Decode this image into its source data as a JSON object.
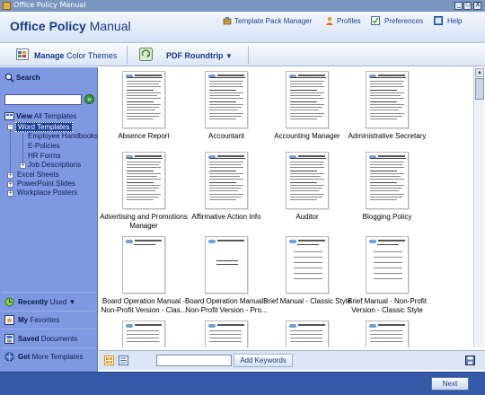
{
  "window": {
    "title": "Office Policy Manual",
    "controls": [
      "_",
      "□",
      "X"
    ]
  },
  "header": {
    "brand_bold": "Office Policy",
    "brand_light": " Manual",
    "links": [
      {
        "label": "Template Pack Manager",
        "icon": "package-icon"
      },
      {
        "label": "Profiles",
        "icon": "profile-icon"
      },
      {
        "label": "Preferences",
        "icon": "preferences-icon"
      },
      {
        "label": "Help",
        "icon": "help-icon"
      }
    ]
  },
  "toolbar": {
    "manage_bold": "Manage",
    "manage_rest": " Color Themes",
    "pdf_label": "PDF Roundtrip",
    "pdf_dropdown": "▼"
  },
  "sidebar": {
    "search_label": "Search",
    "search_go": "»",
    "view_bold": "View",
    "view_rest": " All Templates",
    "tree": [
      {
        "label": "Word Templates",
        "toggle": "−",
        "selected": true
      },
      {
        "label": "Employee Handbooks"
      },
      {
        "label": "E-Policies"
      },
      {
        "label": "HR Forms"
      },
      {
        "label": "Job Descriptions",
        "toggle": "+"
      },
      {
        "label": "Excel Sheets",
        "toggle": "+"
      },
      {
        "label": "PowerPoint Slides",
        "toggle": "+"
      },
      {
        "label": "Workplace Posters",
        "toggle": "+"
      }
    ],
    "recently_bold": "Recently",
    "recently_rest": " Used",
    "recently_dropdown": "▼",
    "favorites_bold": "My",
    "favorites_rest": " Favorites",
    "saved_bold": "Saved",
    "saved_rest": " Documents",
    "get_bold": "Get",
    "get_rest": " More Templates"
  },
  "templates": [
    {
      "line1": "Absence Report",
      "line2": ""
    },
    {
      "line1": "Accountant",
      "line2": ""
    },
    {
      "line1": "Accounting Manager",
      "line2": ""
    },
    {
      "line1": "Administrative Secretary",
      "line2": ""
    },
    {
      "line1": "Advertising and Promotions",
      "line2": "Manager"
    },
    {
      "line1": "Affirmative Action Info",
      "line2": ""
    },
    {
      "line1": "Auditor",
      "line2": ""
    },
    {
      "line1": "Blogging Policy",
      "line2": ""
    },
    {
      "line1": "Board Operation Manual -",
      "line2": "Non-Profit Version - Clas..."
    },
    {
      "line1": "Board Operation Manual -",
      "line2": "Non-Profit Version - Pro..."
    },
    {
      "line1": "Brief Manual - Classic Style",
      "line2": ""
    },
    {
      "line1": "Brief Manual - Non-Profit",
      "line2": "Version - Classic Style"
    }
  ],
  "bottom": {
    "keyword_value": "",
    "add_keywords": "Add Keywords"
  },
  "footer": {
    "next": "Next"
  },
  "colors": {
    "sidebar": "#7f98e2",
    "footer": "#355ba8",
    "brand": "#1a3a8a"
  }
}
